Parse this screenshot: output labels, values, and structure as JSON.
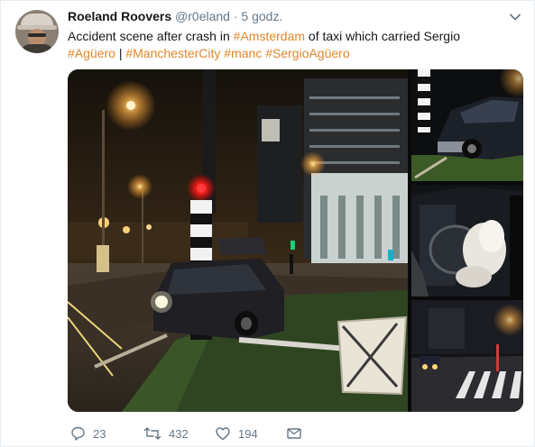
{
  "tweet": {
    "author_name": "Roeland Roovers",
    "handle": "@r0eland",
    "separator": "·",
    "time": "5 godz.",
    "text_before_link": "Accident scene after crash in ",
    "link_amsterdam": "#Amsterdam",
    "text_after_link": " of taxi which carried Sergio",
    "hashtag_aguero": "#Agüero",
    "pipe": "|",
    "hashtag_mancity": "#ManchesterCity",
    "hashtag_manc": "#manc",
    "hashtag_sergioaguero": "#SergioAgüero"
  },
  "actions": {
    "reply_count": "23",
    "retweet_count": "432",
    "like_count": "194"
  },
  "icons": {
    "menu": "chevron-down-icon",
    "reply": "reply-icon",
    "retweet": "retweet-icon",
    "like": "heart-icon",
    "message": "envelope-icon"
  },
  "colors": {
    "hashtag": "#e0862a",
    "secondary_text": "#657786"
  }
}
